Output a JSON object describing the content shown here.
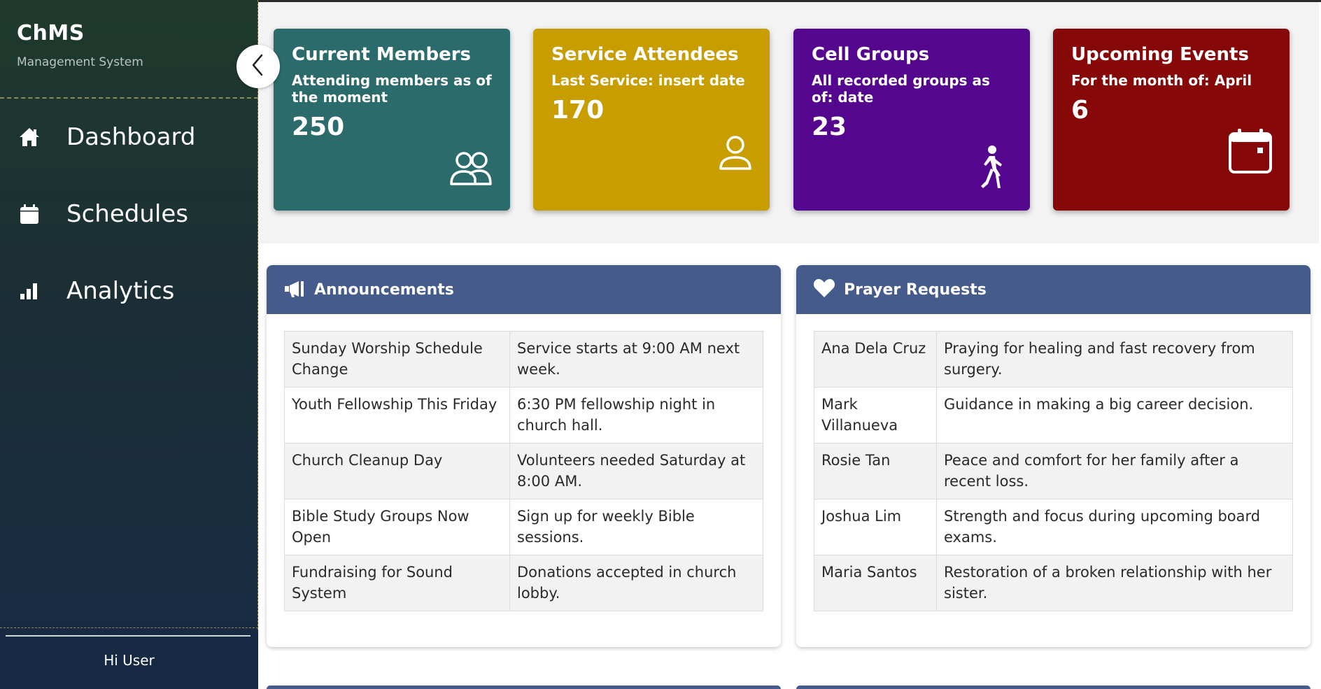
{
  "brand": {
    "title": "ChMS",
    "subtitle": "Management System"
  },
  "nav": [
    {
      "label": "Dashboard",
      "icon": "home-icon"
    },
    {
      "label": "Schedules",
      "icon": "calendar-icon"
    },
    {
      "label": "Analytics",
      "icon": "bar-chart-icon"
    }
  ],
  "user": {
    "greeting": "Hi User"
  },
  "stats": [
    {
      "title": "Current Members",
      "subtitle": "Attending members as of the moment",
      "value": "250",
      "icon": "users-icon",
      "color": "#2b6b6b"
    },
    {
      "title": "Service Attendees",
      "subtitle": "Last Service: insert date",
      "value": "170",
      "icon": "user-icon",
      "color": "#c79d00"
    },
    {
      "title": "Cell Groups",
      "subtitle": "All recorded groups as of: date",
      "value": "23",
      "icon": "walking-icon",
      "color": "#55068e"
    },
    {
      "title": "Upcoming Events",
      "subtitle": "For the month of: April",
      "value": "6",
      "icon": "calendar-icon",
      "color": "#870808"
    }
  ],
  "announcements": {
    "title": "Announcements",
    "icon": "megaphone-icon",
    "rows": [
      {
        "title": "Sunday Worship Schedule Change",
        "detail": "Service starts at 9:00 AM next week."
      },
      {
        "title": "Youth Fellowship This Friday",
        "detail": "6:30 PM fellowship night in church hall."
      },
      {
        "title": "Church Cleanup Day",
        "detail": "Volunteers needed Saturday at 8:00 AM."
      },
      {
        "title": "Bible Study Groups Now Open",
        "detail": "Sign up for weekly Bible sessions."
      },
      {
        "title": "Fundraising for Sound System",
        "detail": "Donations accepted in church lobby."
      }
    ]
  },
  "prayers": {
    "title": "Prayer Requests",
    "icon": "heart-icon",
    "rows": [
      {
        "name": "Ana Dela Cruz",
        "request": "Praying for healing and fast recovery from surgery."
      },
      {
        "name": "Mark Villanueva",
        "request": "Guidance in making a big career decision."
      },
      {
        "name": "Rosie Tan",
        "request": "Peace and comfort for her family after a recent loss."
      },
      {
        "name": "Joshua Lim",
        "request": "Strength and focus during upcoming board exams."
      },
      {
        "name": "Maria Santos",
        "request": "Restoration of a broken relationship with her sister."
      }
    ]
  },
  "colors": {
    "panel_header": "#455b8b",
    "sidebar_top": "#1f3a2c",
    "sidebar_bottom": "#172a45"
  }
}
